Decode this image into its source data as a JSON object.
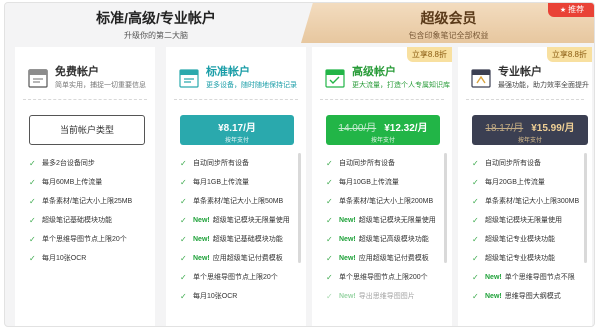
{
  "tabs": {
    "left": {
      "title": "标准/高级/专业帐户",
      "subtitle": "升级你的第二大脑"
    },
    "right": {
      "title": "超级会员",
      "subtitle": "包含印象笔记全部权益",
      "badge": "推荐"
    }
  },
  "plans": [
    {
      "name": "免费帐户",
      "desc": "简单实用，捕捉一切重要信息",
      "button": "当前帐户类型",
      "icon": "free-account-icon",
      "features": [
        {
          "new": "",
          "text": "最多2台设备同步"
        },
        {
          "new": "",
          "text": "每月60MB上传流量"
        },
        {
          "new": "",
          "text": "单条素材/笔记大小上限25MB"
        },
        {
          "new": "",
          "text": "超级笔记基础模块功能"
        },
        {
          "new": "",
          "text": "单个思维导图节点上限20个"
        },
        {
          "new": "",
          "text": "每月10张OCR"
        }
      ]
    },
    {
      "name": "标准帐户",
      "desc": "更多设备，随时随地保持记录",
      "price": "¥8.17/月",
      "renew": "按年支付",
      "color": "#2aa9ad",
      "icon": "standard-account-icon",
      "features": [
        {
          "new": "",
          "text": "自动同步所有设备"
        },
        {
          "new": "",
          "text": "每月1GB上传流量"
        },
        {
          "new": "",
          "text": "单条素材/笔记大小上限50MB"
        },
        {
          "new": "New!",
          "text": "超级笔记模块无限量使用"
        },
        {
          "new": "New!",
          "text": "超级笔记基础模块功能"
        },
        {
          "new": "New!",
          "text": "应用超级笔记付费模板"
        },
        {
          "new": "",
          "text": "单个思维导图节点上限20个"
        },
        {
          "new": "",
          "text": "每月10张OCR"
        }
      ]
    },
    {
      "name": "高级帐户",
      "desc": "更大流量，打造个人专属知识库",
      "discount": "立享8.8折",
      "orig_price": "14.00/月",
      "price": "¥12.32/月",
      "renew": "按年支付",
      "color": "#22b547",
      "icon": "premium-account-icon",
      "features": [
        {
          "new": "",
          "text": "自动同步所有设备"
        },
        {
          "new": "",
          "text": "每月10GB上传流量"
        },
        {
          "new": "",
          "text": "单条素材/笔记大小上限200MB"
        },
        {
          "new": "New!",
          "text": "超级笔记模块无限量使用"
        },
        {
          "new": "New!",
          "text": "超级笔记高级模块功能"
        },
        {
          "new": "New!",
          "text": "应用超级笔记付费模板"
        },
        {
          "new": "",
          "text": "单个思维导图节点上限200个"
        },
        {
          "new": "New!",
          "text": "导出思维导图图片"
        }
      ]
    },
    {
      "name": "专业帐户",
      "desc": "最强功能，助力效率全面提升",
      "discount": "立享8.8折",
      "orig_price": "18.17/月",
      "price": "¥15.99/月",
      "renew": "按年支付",
      "color": "#3b3f52",
      "icon": "professional-account-icon",
      "features": [
        {
          "new": "",
          "text": "自动同步所有设备"
        },
        {
          "new": "",
          "text": "每月20GB上传流量"
        },
        {
          "new": "",
          "text": "单条素材/笔记大小上限300MB"
        },
        {
          "new": "",
          "text": "超级笔记模块无限量使用"
        },
        {
          "new": "",
          "text": "超级笔记专业模块功能"
        },
        {
          "new": "",
          "text": "超级笔记专业模块功能"
        },
        {
          "new": "New!",
          "text": "单个思维导图节点不限"
        },
        {
          "new": "New!",
          "text": "思维导图大纲模式"
        }
      ]
    }
  ]
}
